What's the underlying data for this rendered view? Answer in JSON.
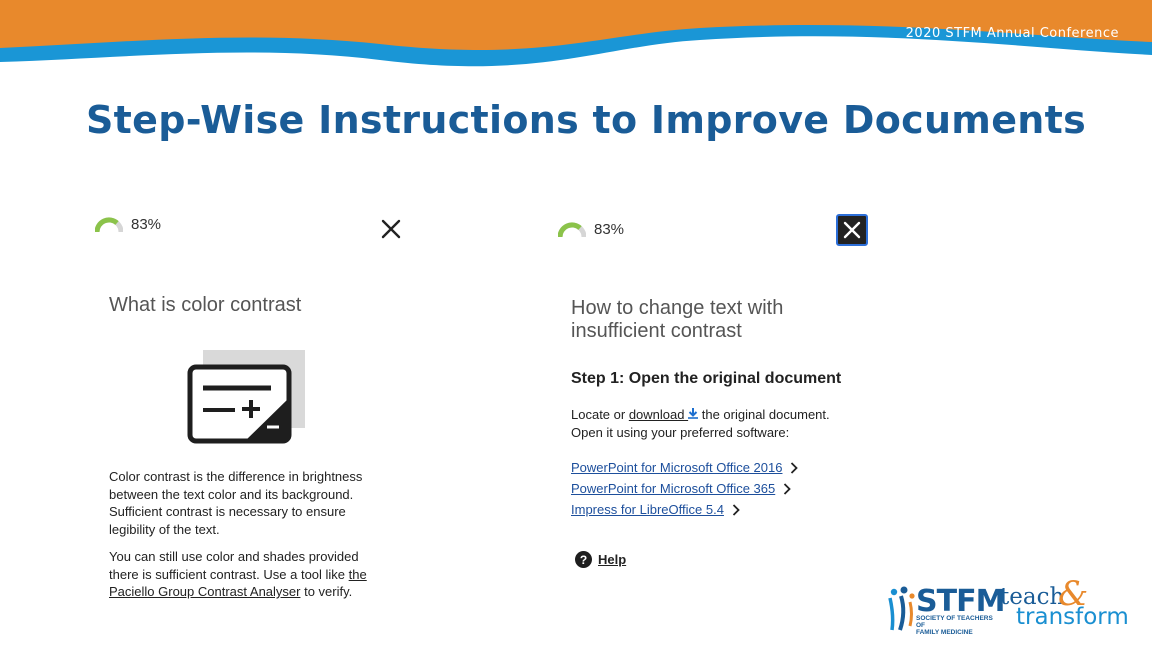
{
  "header": {
    "conference": "2020 STFM Annual Conference",
    "title": "Step-Wise Instructions to Improve Documents",
    "colors": {
      "orange": "#E8892C",
      "blue": "#1A96D6",
      "title": "#1A5C97"
    }
  },
  "left_panel": {
    "score": "83%",
    "close_icon": "close-icon",
    "heading": "What is color contrast",
    "graphic_icon": "contrast-card-icon",
    "para1": "Color contrast is the difference in brightness between the text color and its background. Sufficient contrast is necessary to ensure legibility of the text.",
    "para2_prefix": "You can still use color and shades provided there is sufficient contrast. Use a tool like ",
    "para2_link": "the Paciello Group Contrast Analyser",
    "para2_suffix": " to verify."
  },
  "right_panel": {
    "score": "83%",
    "close_icon": "close-icon",
    "heading_line1": "How to change text with",
    "heading_line2": "insufficient contrast",
    "step_heading": "Step 1: Open the original document",
    "locate_prefix": "Locate or ",
    "download_link": "download",
    "locate_suffix": " the original document.",
    "open_line": "Open it using your preferred software:",
    "links": [
      "PowerPoint for Microsoft Office 2016",
      "PowerPoint for Microsoft Office 365",
      "Impress for LibreOffice 5.4"
    ],
    "help": "Help"
  },
  "logo": {
    "stfm": "STFM",
    "sub_line1": "SOCIETY OF TEACHERS OF",
    "sub_line2": "FAMILY MEDICINE",
    "teach": "teach",
    "amp": "&",
    "transform": "transform"
  }
}
